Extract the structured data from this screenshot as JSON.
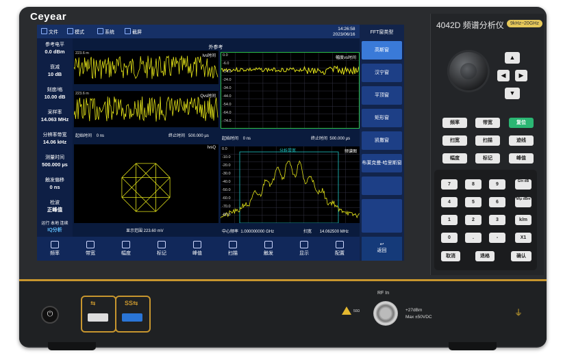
{
  "device": {
    "brand": "Ceyear",
    "model": "4042D 频谱分析仪",
    "freq_badge": "9kHz~20GHz",
    "rf_in_label": "RF In",
    "rf_spec_line1": "+27dBm",
    "rf_spec_line2": "Max ±50VDC",
    "warn_label": "50Ω"
  },
  "topbar": {
    "file": "文件",
    "mode": "模式",
    "system": "系统",
    "screenshot": "截屏",
    "time": "14:26:58",
    "date": "2023/06/16"
  },
  "main_title": "外参考",
  "params": [
    {
      "label": "参考电平",
      "value": "0.0 dBm"
    },
    {
      "label": "衰减",
      "value": "10 dB"
    },
    {
      "label": "刻度/格",
      "value": "10.00 dB"
    },
    {
      "label": "采样率",
      "value": "14.063 MHz"
    },
    {
      "label": "分辨率带宽",
      "value": "14.06 kHz"
    },
    {
      "label": "测量时间",
      "value": "500.000 µs"
    },
    {
      "label": "触发偏移",
      "value": "0 ns"
    },
    {
      "label": "检波",
      "value": "正峰值"
    }
  ],
  "status": {
    "line": "运行 本地 连续",
    "mode": "IQ分析"
  },
  "plots": {
    "ivs_title": "Ivs时间",
    "qvs_title": "Qvs时间",
    "amp_title": "幅度vs时间",
    "iq_title": "IvsQ",
    "spec_title": "频谱图",
    "spec_band_label": "分析带宽",
    "ivs_y": "223.6 m",
    "qvs_y": "223.6 m",
    "amp_y": [
      "0.0",
      "-6.0",
      "-14.0",
      "-24.0",
      "-34.0",
      "-44.0",
      "-54.0",
      "-64.0",
      "-74.0"
    ],
    "spec_y": [
      "0.0",
      "-10.0",
      "-20.0",
      "-30.0",
      "-40.0",
      "-50.0",
      "-60.0",
      "-70.0",
      "-80.0"
    ]
  },
  "info": {
    "left_start_label": "起始时间",
    "left_start_value": "0 ns",
    "left_stop_label": "终止时间",
    "left_stop_value": "500.000 µs",
    "right_start_label": "起始时间",
    "right_start_value": "0 ns",
    "right_stop_label": "终止时间",
    "right_stop_value": "500.000 µs",
    "display_range": "显示范围 223.60 mV",
    "center_label": "中心频率",
    "center_value": "1.000000000 GHz",
    "span_label": "扫宽",
    "span_value": "14.062500 MHz"
  },
  "fft": {
    "title": "FFT窗类型",
    "options": [
      "高斯窗",
      "汉宁窗",
      "平顶窗",
      "矩形窗",
      "凯撒窗",
      "布莱克曼-哈里斯窗"
    ],
    "selected": "高斯窗"
  },
  "softkeys": [
    "频率",
    "带宽",
    "幅度",
    "标记",
    "峰值",
    "扫描",
    "触发",
    "显示",
    "配置"
  ],
  "back_label": "返回",
  "hardkeys": [
    "频率",
    "带宽",
    "复位",
    "扫宽",
    "扫描",
    "迹线",
    "幅度",
    "标记",
    "峰值"
  ],
  "numpad": [
    "7",
    "8",
    "9",
    "G/n dB",
    "4",
    "5",
    "6",
    "M/μ dBm",
    "1",
    "2",
    "3",
    "k/m",
    "0",
    ".",
    "-",
    "X1",
    "取消",
    "退格",
    "确认"
  ]
}
